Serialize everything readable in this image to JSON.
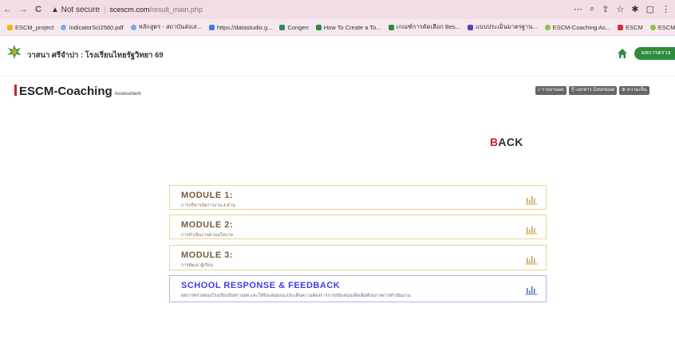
{
  "browser": {
    "back_glyph": "←",
    "forward_glyph": "→",
    "reload_glyph": "C",
    "security_text": "▲ Not secure",
    "host": "scescm.com",
    "path": "/result_main.php",
    "right_icons": [
      "⋯",
      "⌕",
      "⇪",
      "☆",
      "✱",
      "▢",
      "⋮"
    ]
  },
  "bookmarks": [
    {
      "label": "ESCM_project",
      "color": "#f2b700"
    },
    {
      "label": "IndicatorSci2560.pdf",
      "color": "#7aa7e8"
    },
    {
      "label": "หลักสูตร - สถาบันส่งเส...",
      "color": "#7aa7e8"
    },
    {
      "label": "https://datastudio.g...",
      "color": "#3b7ddd"
    },
    {
      "label": "Congen",
      "color": "#2e8b57"
    },
    {
      "label": "How To Create a To...",
      "color": "#2d8a3e"
    },
    {
      "label": "เกณฑ์การคัดเลือก Bes...",
      "color": "#2d8a3e"
    },
    {
      "label": "แบบประเมินมาตรฐาน...",
      "color": "#5a3fc0"
    },
    {
      "label": "ESCM-Coaching As...",
      "color": "#8bc34a"
    },
    {
      "label": "ESCM",
      "color": "#d32f2f"
    },
    {
      "label": "ESCM-Coaching As...",
      "color": "#8bc34a"
    }
  ],
  "header": {
    "school_label": "วาสนา ศรีจำปา : โรงเรียนไทยรัฐวิทยา 69",
    "green_button": "ผลการตรวจ"
  },
  "page": {
    "title": "ESCM-Coaching",
    "subtitle": "Assessment",
    "tools": [
      "⌕ รายงานผล",
      "🖹 เอกสาร Download",
      "⊕ ความเห็น"
    ],
    "back_first": "B",
    "back_rest": "ACK"
  },
  "modules": [
    {
      "title": "MODULE 1:",
      "subtitle": "การบริหารจัดการงาน 4 ด้าน"
    },
    {
      "title": "MODULE 2:",
      "subtitle": "การดำเนินงานตามนโยบาย"
    },
    {
      "title": "MODULE 3:",
      "subtitle": "การพัฒนาผู้เรียน"
    },
    {
      "title": "SCHOOL RESPONSE & FEEDBACK",
      "subtitle": "ผลการตรวจของโรงเรียนรับทราบผล และให้ข้อเสนอแนะประเด็นความต้องการการสนับสนุนเพื่อเพิ่มศักยภาพการดำเนินงาน"
    }
  ],
  "colors": {
    "accent_red": "#d32020",
    "module_border": "#ead49a",
    "feedback_border": "#a9b7e6",
    "feedback_title": "#3d3df0",
    "green": "#2e8b3e"
  }
}
